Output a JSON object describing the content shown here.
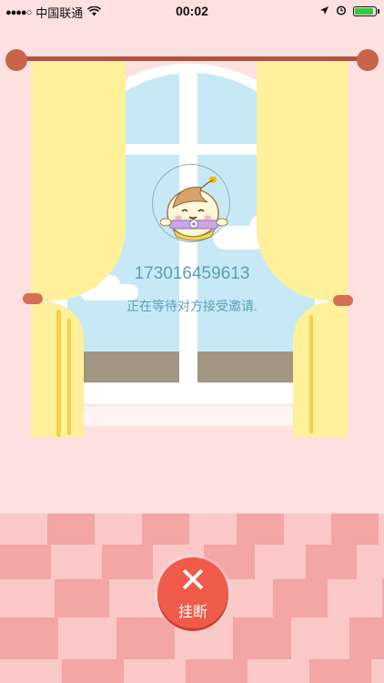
{
  "status_bar": {
    "signal": "●●●●○",
    "carrier": "中国联通",
    "wifi_icon": "wifi-icon",
    "time": "00:02",
    "battery_level": 0.9
  },
  "call": {
    "phone_number": "17301645961 3",
    "status_message": "正在等待对方接受邀请."
  },
  "actions": {
    "hangup_label": "挂断"
  },
  "colors": {
    "wall": "#fde0e0",
    "sky": "#c7e9f5",
    "curtain": "#fff09a",
    "floor_light": "#fbc8c8",
    "floor_dark": "#f4a5a5",
    "hangup": "#f05a4a",
    "text": "#5b9fb7"
  }
}
